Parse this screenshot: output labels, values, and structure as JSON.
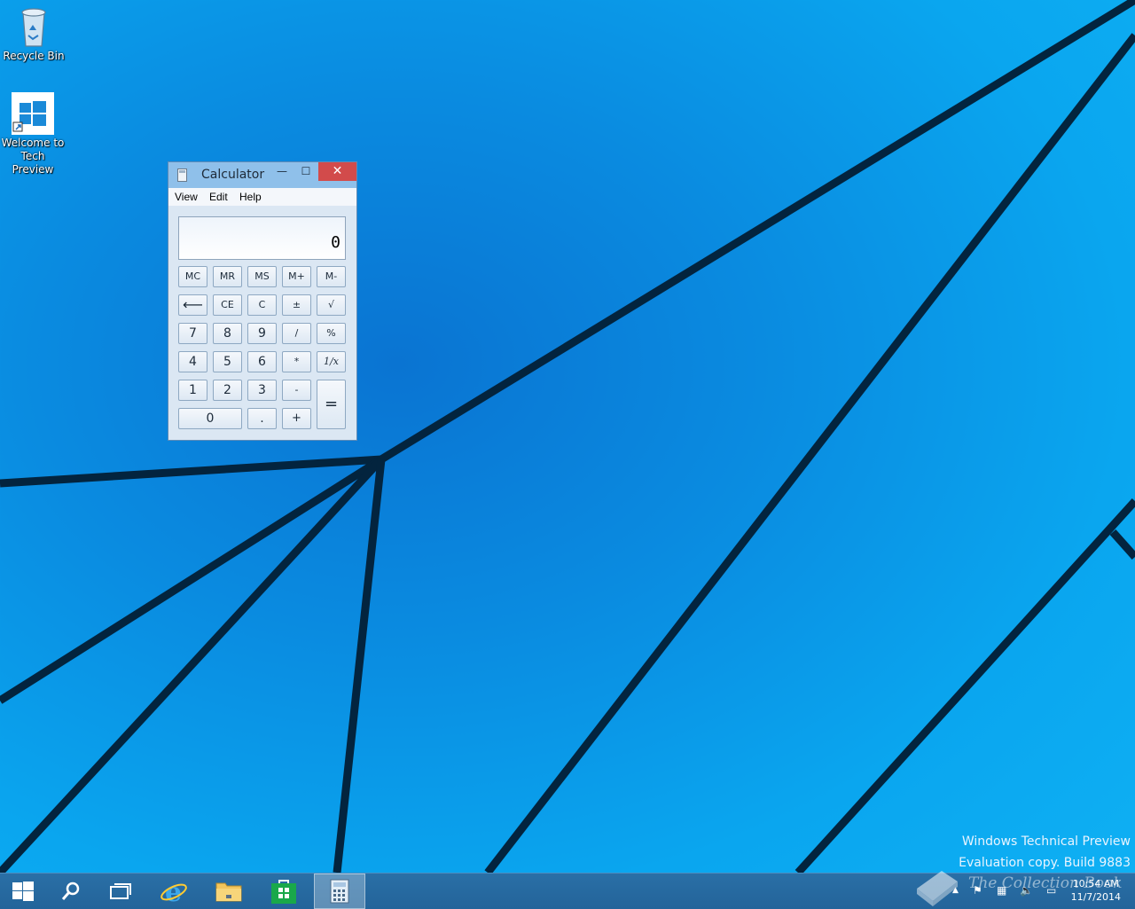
{
  "desktop": {
    "icons": [
      {
        "label": "Recycle Bin",
        "icon": "recycle-bin-icon"
      },
      {
        "label_line1": "Welcome to",
        "label_line2": "Tech Preview",
        "icon": "windows-logo-icon"
      }
    ]
  },
  "calculator": {
    "title": "Calculator",
    "menu": [
      "View",
      "Edit",
      "Help"
    ],
    "display": "0",
    "keys": {
      "mc": "MC",
      "mr": "MR",
      "ms": "MS",
      "mplus": "M+",
      "mminus": "M-",
      "back": "⟵",
      "ce": "CE",
      "c": "C",
      "plusminus": "±",
      "sqrt": "√",
      "k7": "7",
      "k8": "8",
      "k9": "9",
      "div": "/",
      "pct": "%",
      "k4": "4",
      "k5": "5",
      "k6": "6",
      "mul": "*",
      "recip": "1/x",
      "k1": "1",
      "k2": "2",
      "k3": "3",
      "sub": "-",
      "eq": "=",
      "k0": "0",
      "dot": ".",
      "add": "+"
    },
    "close_glyph": "✕",
    "min_glyph": "—",
    "max_glyph": "☐"
  },
  "watermark": {
    "line1": "Windows Technical Preview",
    "line2": "Evaluation copy. Build 9883",
    "overlay": "The Collection Book"
  },
  "taskbar": {
    "buttons": [
      "start-icon",
      "search-icon",
      "task-view-icon",
      "internet-explorer-icon",
      "file-explorer-icon",
      "store-icon",
      "calculator-icon"
    ],
    "clock_time": "10:54 AM",
    "clock_date": "11/7/2014"
  },
  "colors": {
    "taskbar": "#23649a",
    "close": "#d24b4b",
    "title_bar": "#8fc0ea"
  }
}
